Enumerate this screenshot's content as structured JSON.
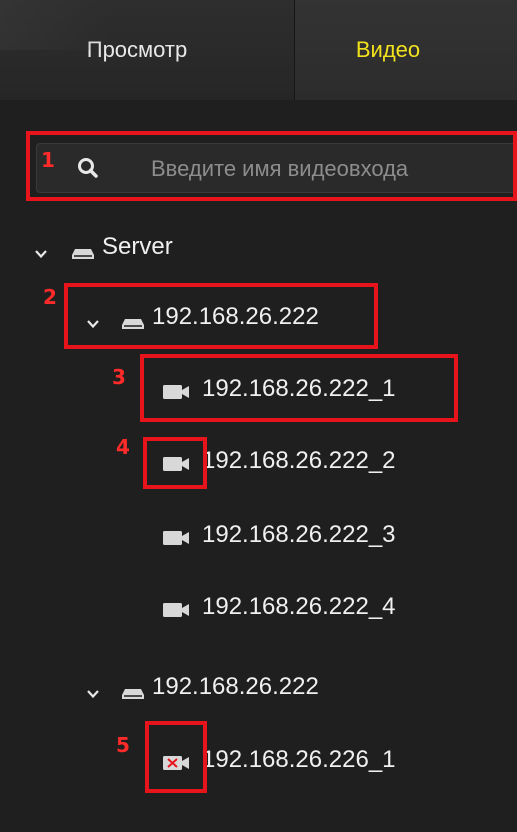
{
  "tabs": [
    {
      "label": "Просмотр",
      "active": false
    },
    {
      "label": "Видео",
      "active": true
    }
  ],
  "search": {
    "placeholder": "Введите имя видеовхода",
    "value": ""
  },
  "tree": {
    "server": {
      "label": "Server",
      "icon": "server-icon",
      "expanded": true
    },
    "group1": {
      "label": "192.168.26.222",
      "icon": "server-icon",
      "expanded": true,
      "channels": [
        {
          "label": "192.168.26.222_1",
          "icon": "camera-icon",
          "status": "online"
        },
        {
          "label": "192.168.26.222_2",
          "icon": "camera-icon",
          "status": "online"
        },
        {
          "label": "192.168.26.222_3",
          "icon": "camera-icon",
          "status": "online"
        },
        {
          "label": "192.168.26.222_4",
          "icon": "camera-icon",
          "status": "online"
        }
      ]
    },
    "group2": {
      "label": "192.168.26.222",
      "icon": "server-icon",
      "expanded": true,
      "channels": [
        {
          "label": "192.168.26.226_1",
          "icon": "camera-offline-icon",
          "status": "offline"
        }
      ]
    }
  },
  "annotations": [
    "1",
    "2",
    "3",
    "4",
    "5"
  ],
  "colors": {
    "background": "#1f1f1f",
    "active_tab_text": "#f2e21d",
    "tab_text": "#e8e8e8",
    "tree_text": "#f0f0f0",
    "annotation_red": "#e8141c",
    "offline_mark": "#e8141c"
  }
}
